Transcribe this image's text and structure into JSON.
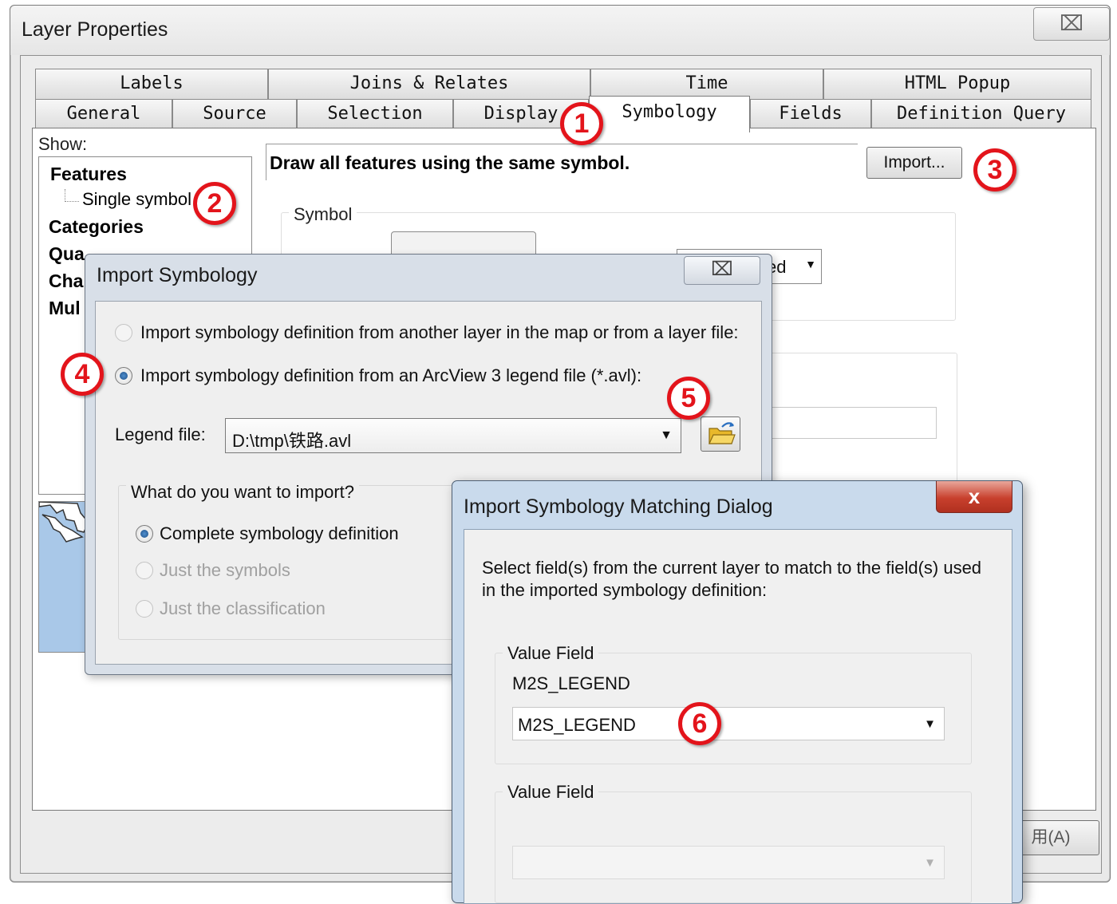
{
  "layer_properties": {
    "title": "Layer Properties",
    "close_glyph": "⌧",
    "tabs_row1": [
      "Labels",
      "Joins & Relates",
      "Time",
      "HTML Popup"
    ],
    "tabs_row2": [
      "General",
      "Source",
      "Selection",
      "Display",
      "Symbology",
      "Fields",
      "Definition Query"
    ],
    "active_tab": "Symbology",
    "show_label": "Show:",
    "show_items": [
      "Features",
      "Categories",
      "Qua",
      "Cha",
      "Mul"
    ],
    "show_subitem": "Single symbol",
    "description": "Draw all features using the same symbol.",
    "import_button": "Import...",
    "symbol_group_label": "Symbol",
    "rotation_value": "ed",
    "apply_button": "用(A)"
  },
  "import_symbology": {
    "title": "Import Symbology",
    "close_glyph": "⌧",
    "option_layer": "Import symbology definition from another layer in the map or from a layer file:",
    "option_avl": "Import symbology definition from an ArcView 3 legend file (*.avl):",
    "selected_option": "avl",
    "legend_file_label": "Legend file:",
    "legend_file_value": "D:\\tmp\\铁路.avl",
    "what_label": "What do you want to import?",
    "import_options": [
      "Complete symbology definition",
      "Just the symbols",
      "Just the classification"
    ],
    "selected_import": "Complete symbology definition",
    "disabled_imports": [
      "Just the symbols",
      "Just the classification"
    ]
  },
  "matching_dialog": {
    "title": "Import Symbology Matching Dialog",
    "close_glyph": "x",
    "instructions": "Select field(s) from the current layer to match to the field(s) used in the imported symbology definition:",
    "value_fields": [
      {
        "label": "Value Field",
        "source_field": "M2S_LEGEND",
        "selected": "M2S_LEGEND",
        "enabled": true
      },
      {
        "label": "Value Field",
        "source_field": "",
        "selected": "",
        "enabled": false
      }
    ]
  },
  "markers": [
    "1",
    "2",
    "3",
    "4",
    "5",
    "6"
  ],
  "colors": {
    "marker_red": "#e3141b",
    "preview_water": "#a9c8e8",
    "close_red": "#c8402d"
  }
}
